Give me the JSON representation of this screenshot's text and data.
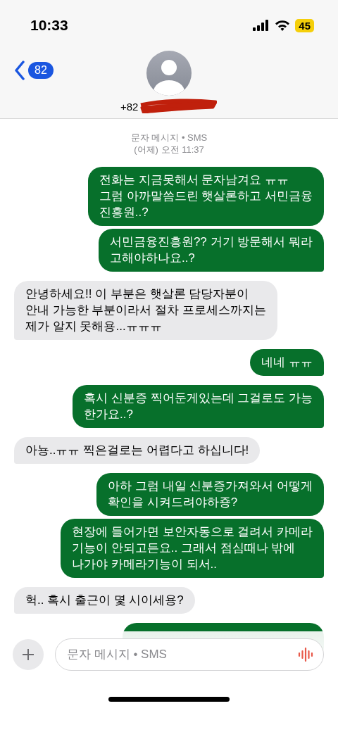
{
  "status_bar": {
    "time": "10:33",
    "battery": "45"
  },
  "header": {
    "back_count": "82",
    "contact": "+82"
  },
  "thread_info": {
    "service": "문자 메시지 • SMS",
    "timestamp": "(어제) 오전 11:37"
  },
  "messages": [
    {
      "kind": "sent",
      "text": "전화는 지금못해서 문자남겨요 ㅠㅠ\n그럼 아까말씀드린 햇살론하고 서민금융\n진흥원..?",
      "tail": false
    },
    {
      "kind": "sent",
      "text": "서민금융진흥원?? 거기 방문해서 뭐라\n고해야하나요..?",
      "tail": true
    },
    {
      "kind": "received",
      "text": "안녕하세요!! 이 부분은 햇살론 담당자분이\n안내 가능한 부분이라서 절차 프로세스까지는\n제가 알지 못해용...ㅠㅠㅠ",
      "tail": true
    },
    {
      "kind": "sent",
      "text": "네네 ㅠㅠ",
      "tail": true
    },
    {
      "kind": "sent",
      "text": "혹시 신분증 찍어둔게있는데 그걸로도 가능\n한가요..?",
      "tail": true
    },
    {
      "kind": "received",
      "text": "아뇽..ㅠㅠ 찍은걸로는 어렵다고 하십니다!",
      "tail": true
    },
    {
      "kind": "sent",
      "text": "아하 그럼 내일 신분증가져와서 어떻게\n확인을 시켜드려야하죵?",
      "tail": false
    },
    {
      "kind": "sent",
      "text": "현장에 들어가면 보안자동으로 걸려서 카메라\n기능이 안되고든요.. 그래서 점심때나 밖에\n나가야 카메라기능이 되서..",
      "tail": true
    },
    {
      "kind": "received",
      "text": "헉.. 혹시 출근이 몇 시이세용?",
      "tail": true
    },
    {
      "kind": "sent"
    }
  ],
  "composer": {
    "placeholder": "문자 메시지 • SMS"
  }
}
